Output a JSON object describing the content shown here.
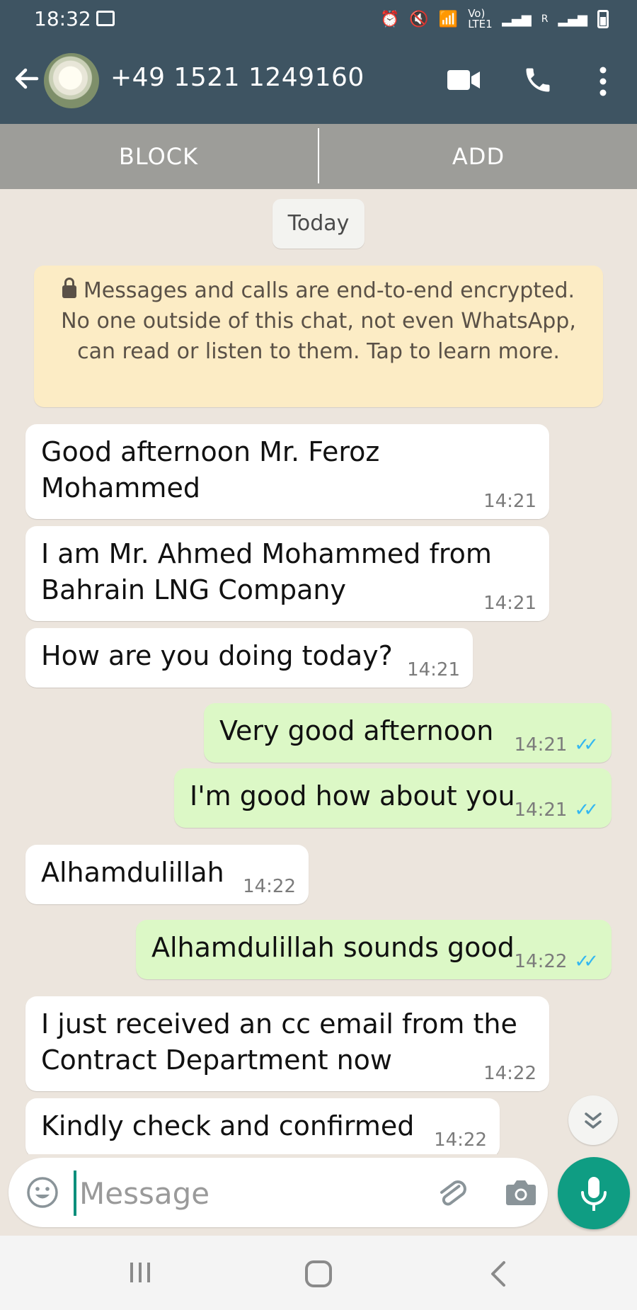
{
  "status_bar": {
    "time": "18:32",
    "network": "Vo) LTE1",
    "roaming": "R"
  },
  "header": {
    "contact": "+49 1521 1249160"
  },
  "actions": {
    "block": "BLOCK",
    "add": "ADD"
  },
  "chat": {
    "date_chip": "Today",
    "encryption_notice": "Messages and calls are end-to-end encrypted. No one outside of this chat, not even WhatsApp, can read or listen to them. Tap to learn more.",
    "messages": [
      {
        "direction": "incoming",
        "lines": [
          "Good afternoon Mr. Feroz",
          "Mohammed"
        ],
        "time": "14:21"
      },
      {
        "direction": "incoming",
        "lines": [
          "I am Mr. Ahmed Mohammed from",
          "Bahrain LNG Company"
        ],
        "time": "14:21"
      },
      {
        "direction": "incoming",
        "lines": [
          "How are you doing today?"
        ],
        "time": "14:21"
      },
      {
        "direction": "outgoing",
        "lines": [
          "Very good afternoon"
        ],
        "time": "14:21",
        "status": "read"
      },
      {
        "direction": "outgoing",
        "lines": [
          "I'm good how about you"
        ],
        "time": "14:21",
        "status": "read"
      },
      {
        "direction": "incoming",
        "lines": [
          "Alhamdulillah"
        ],
        "time": "14:22"
      },
      {
        "direction": "outgoing",
        "lines": [
          "Alhamdulillah sounds good"
        ],
        "time": "14:22",
        "status": "read"
      },
      {
        "direction": "incoming",
        "lines": [
          "I just received an cc email from the",
          "Contract Department now"
        ],
        "time": "14:22"
      },
      {
        "direction": "incoming",
        "lines": [
          "Kindly check and confirmed"
        ],
        "time": "14:22"
      }
    ]
  },
  "composer": {
    "placeholder": "Message"
  },
  "colors": {
    "header": "#3e5462",
    "action_bar": "#9d9d99",
    "chat_bg": "#ece5dd",
    "outgoing_bubble": "#dcf8c6",
    "notice_bg": "#fcecc5",
    "accent": "#0f9d83",
    "read_tick": "#34b7f1"
  }
}
